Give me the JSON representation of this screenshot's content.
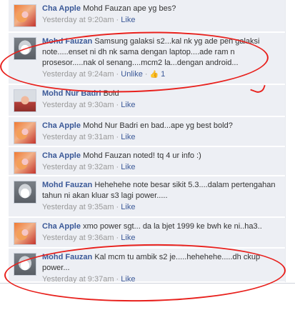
{
  "comments": [
    {
      "author": "Cha Apple",
      "text": "Mohd Fauzan ape yg bes?",
      "time": "Yesterday at 9:20am",
      "like": "Like"
    },
    {
      "author": "Mohd Fauzan",
      "text": "Samsung galaksi s2...kal nk yg ade pen galaksi note.....enset ni dh nk sama dengan laptop....ade ram n prosesor.....nak ol senang....mcm2 la...dengan android...",
      "time": "Yesterday at 9:24am",
      "unlike": "Unlike",
      "likes": "1"
    },
    {
      "author": "Mohd Nur Badri",
      "text": "Bold",
      "time": "Yesterday at 9:30am",
      "like": "Like"
    },
    {
      "author": "Cha Apple",
      "text": "Mohd Nur Badri en bad...ape yg best bold?",
      "time": "Yesterday at 9:31am",
      "like": "Like"
    },
    {
      "author": "Cha Apple",
      "text": "Mohd Fauzan noted! tq 4 ur info :)",
      "time": "Yesterday at 9:32am",
      "like": "Like"
    },
    {
      "author": "Mohd Fauzan",
      "text": "Hehehehe note besar sikit 5.3....dalam pertengahan tahun ni akan kluar s3 lagi power.....",
      "time": "Yesterday at 9:35am",
      "like": "Like"
    },
    {
      "author": "Cha Apple",
      "text": "xmo power sgt... da la bjet 1999 ke bwh ke ni..ha3..",
      "time": "Yesterday at 9:36am",
      "like": "Like"
    },
    {
      "author": "Mohd Fauzan",
      "text": "Kal mcm tu ambik s2 je.....hehehehe.....dh ckup power...",
      "time": "Yesterday at 9:37am",
      "like": "Like"
    }
  ],
  "separator": " · ",
  "icons": {
    "thumb": "thumbs-up-icon"
  },
  "colors": {
    "author": "#3b5998",
    "background": "#edeff4",
    "annotation": "#e8201c"
  }
}
